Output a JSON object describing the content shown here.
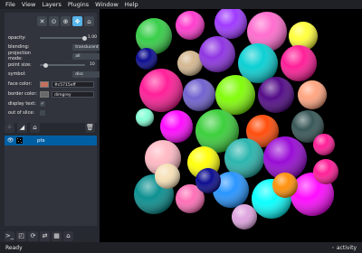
{
  "menu": [
    "File",
    "View",
    "Layers",
    "Plugins",
    "Window",
    "Help"
  ],
  "tools": [
    {
      "name": "delete-points-tool",
      "glyph": "✕",
      "active": false
    },
    {
      "name": "select-points-tool",
      "glyph": "⊙",
      "active": false
    },
    {
      "name": "add-points-tool",
      "glyph": "⊕",
      "active": false
    },
    {
      "name": "pan-zoom-tool",
      "glyph": "✥",
      "active": true
    },
    {
      "name": "transform-tool",
      "glyph": "⌂",
      "active": false
    }
  ],
  "controls": {
    "opacity": {
      "label": "opacity:",
      "value": "1.00",
      "level": 1.0
    },
    "blending": {
      "label": "blending:",
      "value": "translucent"
    },
    "projection_mode": {
      "label": "projection mode:",
      "value": "all"
    },
    "point_size": {
      "label": "point size:",
      "value": "10",
      "level": 0.1
    },
    "symbol": {
      "label": "symbol:",
      "value": "disc"
    },
    "face_color": {
      "label": "face color:",
      "value": "#c5715eff",
      "color": "#c5715e"
    },
    "border_color": {
      "label": "border color:",
      "value": "dimgrey",
      "color": "#696969"
    },
    "display_text": {
      "label": "display text:",
      "checked": true
    },
    "out_of_slice": {
      "label": "out of slice:",
      "checked": false
    }
  },
  "layers": [
    {
      "name": "pts",
      "visible": true,
      "selected": true
    }
  ],
  "status": {
    "left": "Ready",
    "right": "◦ activity"
  }
}
